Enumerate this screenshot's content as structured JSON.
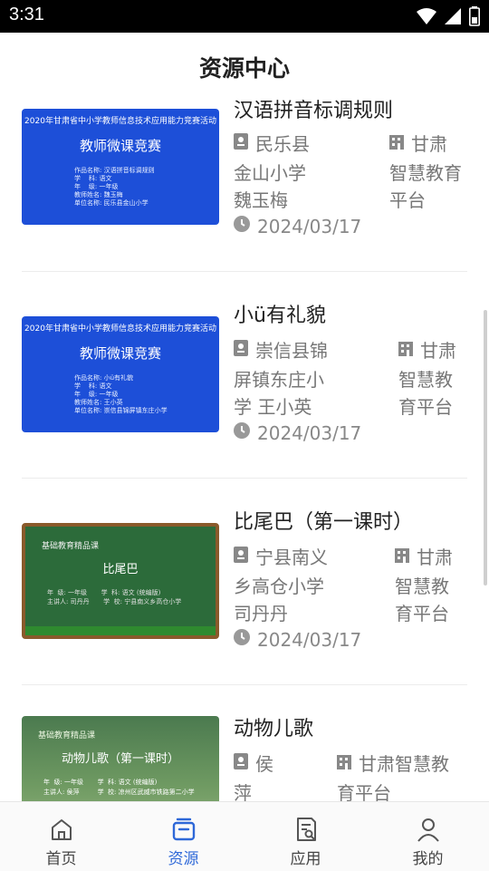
{
  "status_bar": {
    "time": "3:31"
  },
  "header": {
    "title": "资源中心"
  },
  "items": [
    {
      "title": "汉语拼音标调规则",
      "author": "民乐县\n金山小学\n魏玉梅",
      "source": "甘肃\n智慧教育\n平台",
      "date": "2024/03/17",
      "thumb": {
        "line1": "2020年甘肃省中小学教师信息技术应用能力竞赛活动",
        "big": "教师微课竞赛",
        "small": "作品名称: 汉语拼音标调规则\n学    科: 语文\n年    级: 一年级\n教师姓名: 魏玉梅\n单位名称: 民乐县金山小学"
      }
    },
    {
      "title": "小ü有礼貌",
      "author": "崇信县锦\n屏镇东庄小\n学 王小英",
      "source": "甘肃\n智慧教\n育平台",
      "date": "2024/03/17",
      "thumb": {
        "line1": "2020年甘肃省中小学教师信息技术应用能力竞赛活动",
        "big": "教师微课竞赛",
        "small": "作品名称: 小ü有礼貌\n学    科: 语文\n年    级: 一年级\n教师姓名: 王小英\n单位名称: 崇信县锦屏镇东庄小学"
      }
    },
    {
      "title": "比尾巴（第一课时）",
      "author": "宁县南义\n乡高仓小学\n司丹丹",
      "source": "甘肃\n智慧教\n育平台",
      "date": "2024/03/17",
      "thumb": {
        "line1": "基础教育精品课",
        "big": "比尾巴",
        "small": "年  级: 一年级       学  科: 语文 (统编版)\n主讲人: 司丹丹       学  校: 宁县南义乡高仓小学"
      }
    },
    {
      "title": "动物儿歌",
      "author": "侯\n萍",
      "source": "甘肃智慧教\n育平台",
      "date": "",
      "thumb": {
        "line1": "基础教育精品课",
        "big": "动物儿歌（第一课时）",
        "small": "年  级: 一年级       学  科: 语文 (统编版)\n主讲人: 侯萍         学  校: 凉州区武威市铁路第二小学"
      }
    }
  ],
  "tabs": [
    {
      "label": "首页",
      "icon": "home-icon"
    },
    {
      "label": "资源",
      "icon": "resource-box-icon",
      "active": true
    },
    {
      "label": "应用",
      "icon": "app-doc-icon"
    },
    {
      "label": "我的",
      "icon": "person-icon"
    }
  ],
  "colors": {
    "accent": "#2e68d8",
    "text": "#222222",
    "meta": "#777777"
  }
}
